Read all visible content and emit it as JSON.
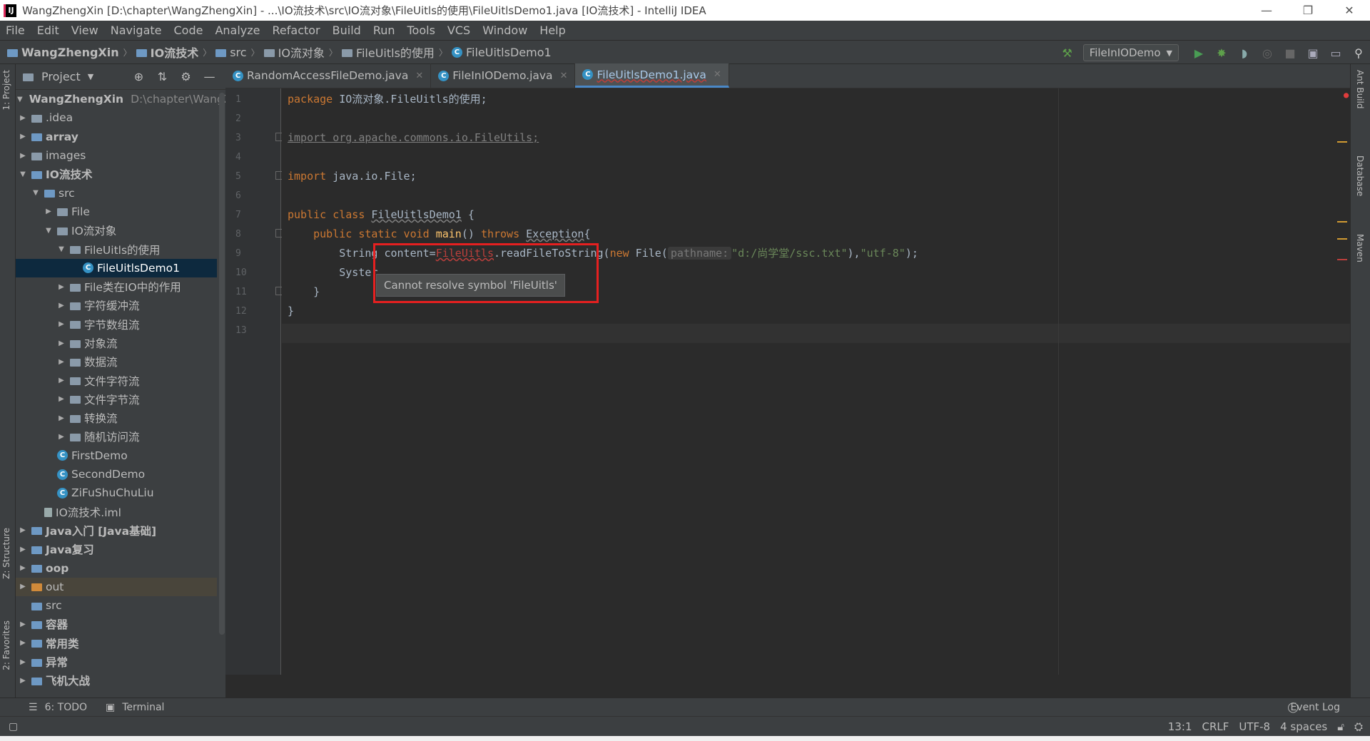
{
  "window": {
    "title": "WangZhengXin [D:\\chapter\\WangZhengXin] - ...\\IO流技术\\src\\IO流对象\\FileUitls的使用\\FileUitlsDemo1.java [IO流技术] - IntelliJ IDEA",
    "app_icon": "IJ",
    "minimize": "—",
    "restore": "❐",
    "close": "✕"
  },
  "menu": [
    "File",
    "Edit",
    "View",
    "Navigate",
    "Code",
    "Analyze",
    "Refactor",
    "Build",
    "Run",
    "Tools",
    "VCS",
    "Window",
    "Help"
  ],
  "breadcrumb": [
    "WangZhengXin",
    "IO流技术",
    "src",
    "IO流对象",
    "FileUitls的使用",
    "FileUitlsDemo1"
  ],
  "run_config": "FileInIODemo",
  "left_tabs": {
    "project": "1: Project",
    "structure": "Z: Structure",
    "favorites": "2: Favorites"
  },
  "project_panel": {
    "title": "Project",
    "tree": [
      {
        "label": "WangZhengXin",
        "path": "D:\\chapter\\WangZh",
        "indent": 0,
        "arrow": "▼",
        "icon": "module",
        "bold": true
      },
      {
        "label": ".idea",
        "indent": 0,
        "arrow": "▶",
        "icon": "folder"
      },
      {
        "label": "array",
        "indent": 0,
        "arrow": "▶",
        "icon": "module",
        "bold": true
      },
      {
        "label": "images",
        "indent": 0,
        "arrow": "▶",
        "icon": "folder"
      },
      {
        "label": "IO流技术",
        "indent": 0,
        "arrow": "▼",
        "icon": "module",
        "bold": true
      },
      {
        "label": "src",
        "indent": 1,
        "arrow": "▼",
        "icon": "src"
      },
      {
        "label": "File",
        "indent": 2,
        "arrow": "▶",
        "icon": "folder"
      },
      {
        "label": "IO流对象",
        "indent": 2,
        "arrow": "▼",
        "icon": "folder"
      },
      {
        "label": "FileUitls的使用",
        "indent": 3,
        "arrow": "▼",
        "icon": "folder"
      },
      {
        "label": "FileUitlsDemo1",
        "indent": 4,
        "arrow": "",
        "icon": "class",
        "selected": true
      },
      {
        "label": "File类在IO中的作用",
        "indent": 3,
        "arrow": "▶",
        "icon": "folder"
      },
      {
        "label": "字符缓冲流",
        "indent": 3,
        "arrow": "▶",
        "icon": "folder"
      },
      {
        "label": "字节数组流",
        "indent": 3,
        "arrow": "▶",
        "icon": "folder"
      },
      {
        "label": "对象流",
        "indent": 3,
        "arrow": "▶",
        "icon": "folder"
      },
      {
        "label": "数据流",
        "indent": 3,
        "arrow": "▶",
        "icon": "folder"
      },
      {
        "label": "文件字符流",
        "indent": 3,
        "arrow": "▶",
        "icon": "folder"
      },
      {
        "label": "文件字节流",
        "indent": 3,
        "arrow": "▶",
        "icon": "folder"
      },
      {
        "label": "转换流",
        "indent": 3,
        "arrow": "▶",
        "icon": "folder"
      },
      {
        "label": "随机访问流",
        "indent": 3,
        "arrow": "▶",
        "icon": "folder"
      },
      {
        "label": "FirstDemo",
        "indent": 2,
        "arrow": "",
        "icon": "class"
      },
      {
        "label": "SecondDemo",
        "indent": 2,
        "arrow": "",
        "icon": "class"
      },
      {
        "label": "ZiFuShuChuLiu",
        "indent": 2,
        "arrow": "",
        "icon": "class"
      },
      {
        "label": "IO流技术.iml",
        "indent": 1,
        "arrow": "",
        "icon": "file"
      },
      {
        "label": "Java入门 [Java基础]",
        "indent": 0,
        "arrow": "▶",
        "icon": "module",
        "bold": true
      },
      {
        "label": "Java复习",
        "indent": 0,
        "arrow": "▶",
        "icon": "module",
        "bold": true
      },
      {
        "label": "oop",
        "indent": 0,
        "arrow": "▶",
        "icon": "module",
        "bold": true
      },
      {
        "label": "out",
        "indent": 0,
        "arrow": "▶",
        "icon": "out",
        "outrow": true
      },
      {
        "label": "src",
        "indent": 0,
        "arrow": "",
        "icon": "src"
      },
      {
        "label": "容器",
        "indent": 0,
        "arrow": "▶",
        "icon": "module",
        "bold": true
      },
      {
        "label": "常用类",
        "indent": 0,
        "arrow": "▶",
        "icon": "module",
        "bold": true
      },
      {
        "label": "异常",
        "indent": 0,
        "arrow": "▶",
        "icon": "module",
        "bold": true
      },
      {
        "label": "飞机大战",
        "indent": 0,
        "arrow": "▶",
        "icon": "module",
        "bold": true
      }
    ]
  },
  "tabs": [
    {
      "label": "RandomAccessFileDemo.java",
      "active": false
    },
    {
      "label": "FileInIODemo.java",
      "active": false
    },
    {
      "label": "FileUitlsDemo1.java",
      "active": true
    }
  ],
  "editor": {
    "line_numbers": [
      "1",
      "2",
      "3",
      "4",
      "5",
      "6",
      "7",
      "8",
      "9",
      "10",
      "11",
      "12",
      "13"
    ],
    "line1": {
      "kw": "package",
      "rest": " IO流对象.FileUitls的使用;"
    },
    "line3": "import org.apache.commons.io.FileUtils;",
    "line5": {
      "kw": "import",
      "rest": " java.io.File;"
    },
    "line7": {
      "kw": "public class",
      "cls": "FileUitlsDemo1",
      "rest": " {"
    },
    "line8": {
      "kw1": "public static void",
      "fn": "main",
      "mid": "() ",
      "kw2": "throws",
      "exc": "Exception",
      "end": "{"
    },
    "line9": {
      "a": "String content=",
      "err": "FileUitls",
      "b": ".readFileToString(",
      "kw": "new",
      "c": " File(",
      "hint": "pathname:",
      "s1": "\"d:/尚学堂/ssc.txt\"",
      "d": "),",
      "s2": "\"utf-8\"",
      "e": ");"
    },
    "line10": "Syster",
    "line11": "}",
    "line12": "}",
    "tooltip": "Cannot resolve symbol 'FileUitls'"
  },
  "right_tabs": [
    "Ant Build",
    "Database",
    "Maven"
  ],
  "bottom_tools": {
    "todo": "6: TODO",
    "terminal": "Terminal",
    "event_log": "Event Log"
  },
  "status": {
    "position": "13:1",
    "line_sep": "CRLF",
    "encoding": "UTF-8",
    "indent": "4 spaces"
  },
  "colors": {
    "selection": "#0d293e",
    "error_box": "#e52020",
    "keyword": "#cc7832",
    "string": "#6a8759"
  }
}
